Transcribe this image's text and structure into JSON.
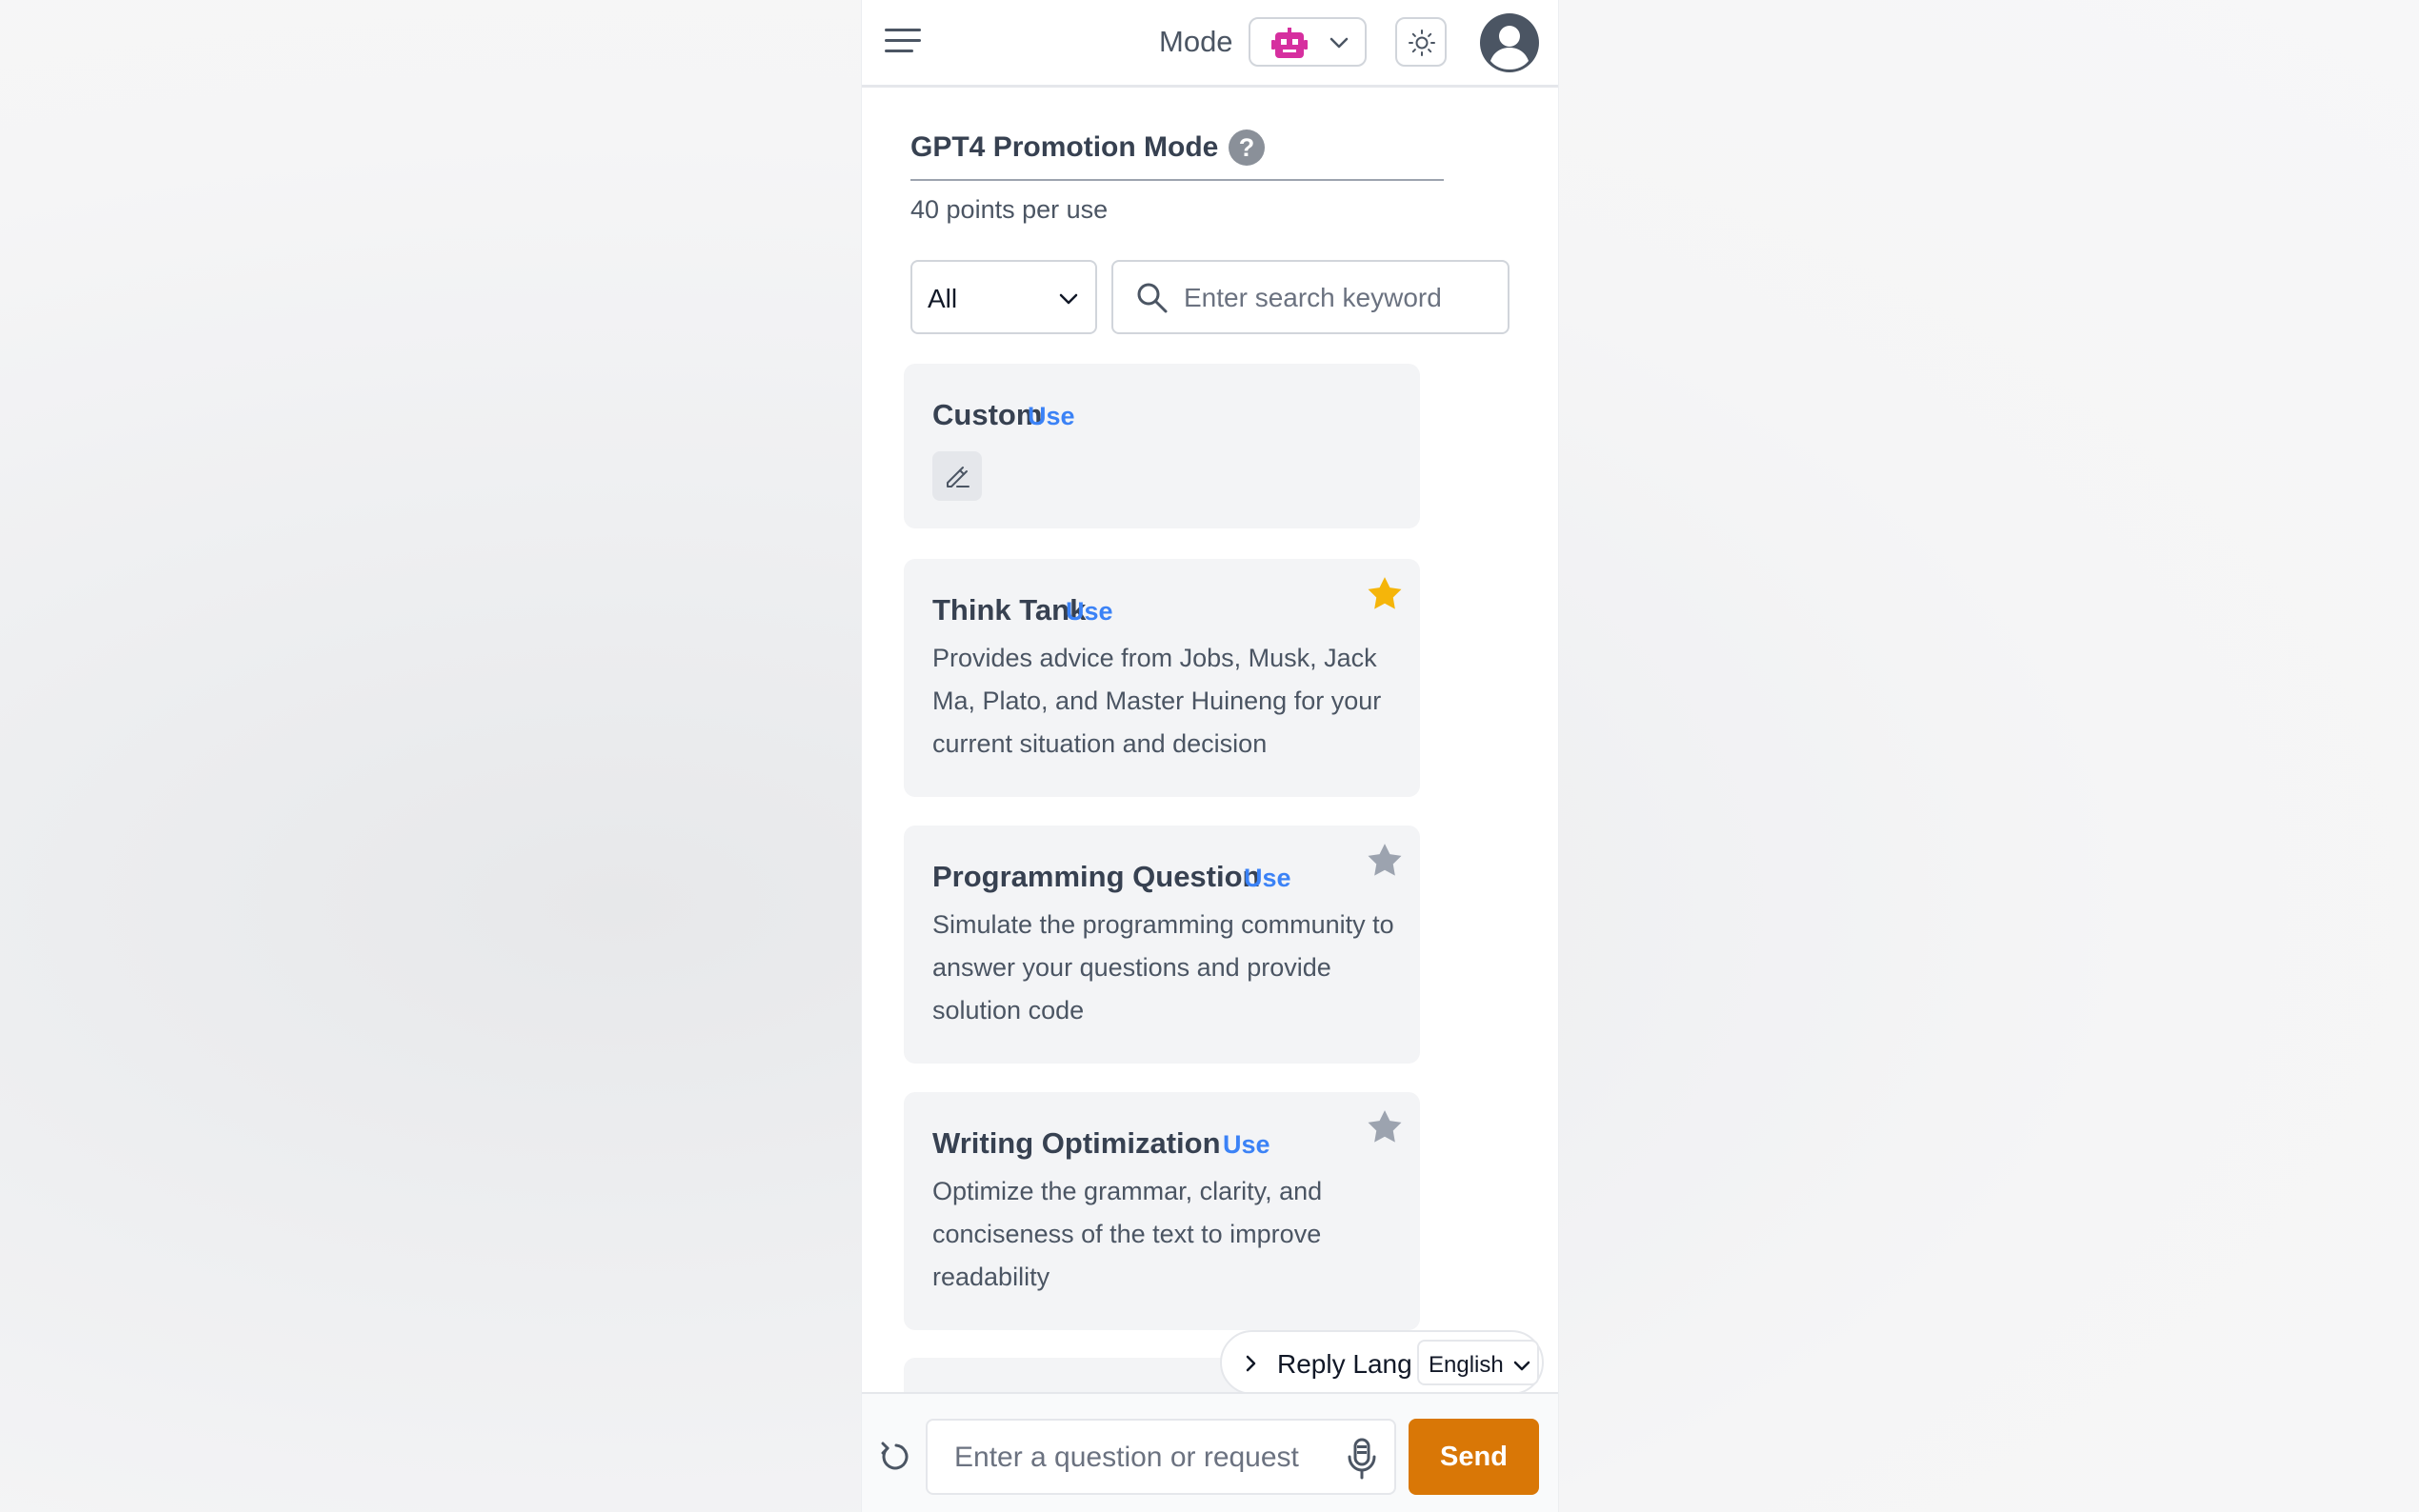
{
  "header": {
    "mode_label": "Mode",
    "mode_icon": "robot-icon",
    "theme_icon": "sun-icon",
    "avatar_icon": "user-avatar-icon"
  },
  "promo": {
    "title": "GPT4 Promotion Mode",
    "help_glyph": "?",
    "subtitle": "40 points per use"
  },
  "filter": {
    "selected": "All",
    "search_placeholder": "Enter search keyword",
    "search_value": ""
  },
  "cards": [
    {
      "title": "Custom",
      "use_label": "Use",
      "description": "",
      "icon": "edit-pencil-icon"
    },
    {
      "title": "Think Tank",
      "use_label": "Use",
      "description": "Provides advice from Jobs, Musk, Jack Ma, Plato, and Master Huineng for your current situation and decision",
      "starred": true
    },
    {
      "title": "Programming Question",
      "use_label": "Use",
      "description": "Simulate the programming community to answer your questions and provide solution code",
      "starred": false
    },
    {
      "title": "Writing Optimization",
      "use_label": "Use",
      "description": "Optimize the grammar, clarity, and conciseness of the text to improve readability",
      "starred": false
    }
  ],
  "reply_lang": {
    "label": "Reply Lang",
    "selected": "English"
  },
  "composer": {
    "placeholder": "Enter a question or request",
    "value": "",
    "send_label": "Send"
  },
  "colors": {
    "accent": "#d97706",
    "link": "#3b82f6",
    "star_active": "#f5b50a",
    "star_inactive": "#9ca3af",
    "robot": "#d62f9f"
  }
}
